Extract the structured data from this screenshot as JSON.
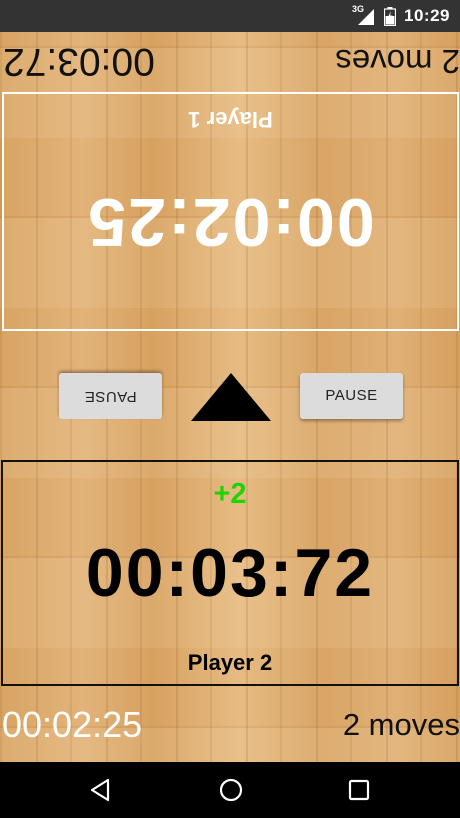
{
  "status_bar": {
    "network": "3G",
    "time": "10:29",
    "icons": [
      "signal-icon",
      "battery-icon"
    ]
  },
  "top_info": {
    "time": "00:03:72",
    "moves": "2 moves"
  },
  "player1": {
    "clock": "00:02:25",
    "name": "Player 1"
  },
  "controls": {
    "pause_p1_label": "PAUSE",
    "pause_p2_label": "PAUSE",
    "turn_indicator_icon": "triangle-up-icon"
  },
  "player2": {
    "bonus": "+2",
    "clock": "00:03:72",
    "name": "Player 2"
  },
  "bottom_info": {
    "time": "00:02:25",
    "moves": "2 moves"
  },
  "nav_bar": {
    "icons": [
      "back-icon",
      "home-icon",
      "recents-icon"
    ]
  },
  "colors": {
    "bonus_green": "#1fd400",
    "button_gray": "#dcdcdc",
    "status_bar": "#333333",
    "nav_bar": "#000000",
    "wood": "#d9a868"
  }
}
